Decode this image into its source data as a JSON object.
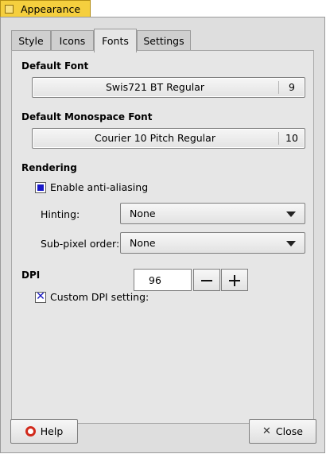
{
  "window": {
    "title": "Appearance"
  },
  "tabs": [
    {
      "label": "Style",
      "active": false
    },
    {
      "label": "Icons",
      "active": false
    },
    {
      "label": "Fonts",
      "active": true
    },
    {
      "label": "Settings",
      "active": false
    }
  ],
  "fonts": {
    "default_heading": "Default Font",
    "default_font": {
      "name": "Swis721 BT Regular",
      "size": "9"
    },
    "mono_heading": "Default Monospace Font",
    "mono_font": {
      "name": "Courier 10 Pitch Regular",
      "size": "10"
    }
  },
  "rendering": {
    "heading": "Rendering",
    "antialias_label": "Enable anti-aliasing",
    "antialias_checked": true,
    "hinting_label": "Hinting:",
    "hinting_value": "None",
    "subpixel_label": "Sub-pixel order:",
    "subpixel_value": "None"
  },
  "dpi": {
    "heading": "DPI",
    "custom_label": "Custom DPI setting:",
    "custom_checked": true,
    "value": "96"
  },
  "buttons": {
    "help": "Help",
    "close": "Close"
  },
  "colors": {
    "title_tab": "#f5cf3e",
    "checkbox_mark": "#1818c8"
  }
}
